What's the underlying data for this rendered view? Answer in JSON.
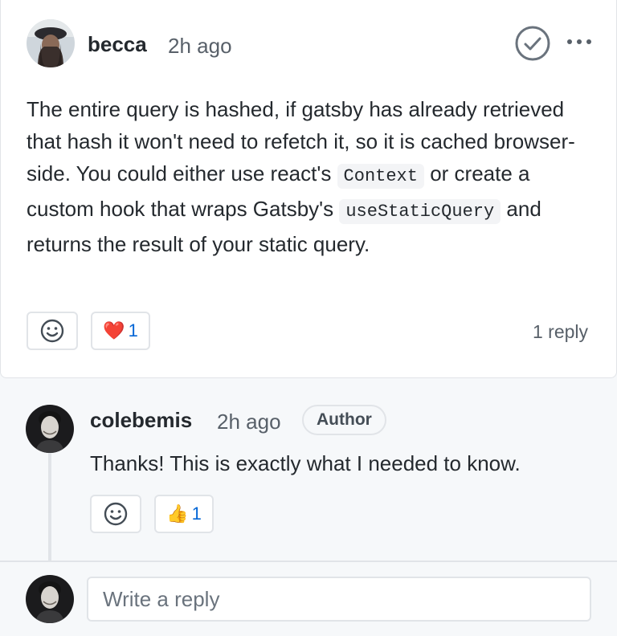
{
  "comment": {
    "author": "becca",
    "time": "2h ago",
    "body": {
      "p1": "The entire query is hashed, if gatsby has already retrieved that hash it won't need to refetch it, so it is cached browser-side. You could either use react's ",
      "code1": "Context",
      "p2": " or create a custom hook that wraps Gatsby's ",
      "code2": "useStaticQuery",
      "p3": " and returns the result of your static query."
    },
    "reactions": [
      {
        "emoji": "❤️",
        "count": "1"
      }
    ],
    "reply_count": "1 reply"
  },
  "reply": {
    "author": "colebemis",
    "time": "2h ago",
    "badge": "Author",
    "body": "Thanks! This is exactly what I needed to know.",
    "reactions": [
      {
        "emoji": "👍",
        "count": "1"
      }
    ]
  },
  "composer": {
    "placeholder": "Write a reply"
  },
  "colors": {
    "link_blue": "#0366d6",
    "border": "#e1e4e8",
    "muted_text": "#586069"
  },
  "icons": {
    "add_reaction": "smiley-icon",
    "mark_answer": "check-circle-icon",
    "more": "kebab-horizontal-icon"
  }
}
